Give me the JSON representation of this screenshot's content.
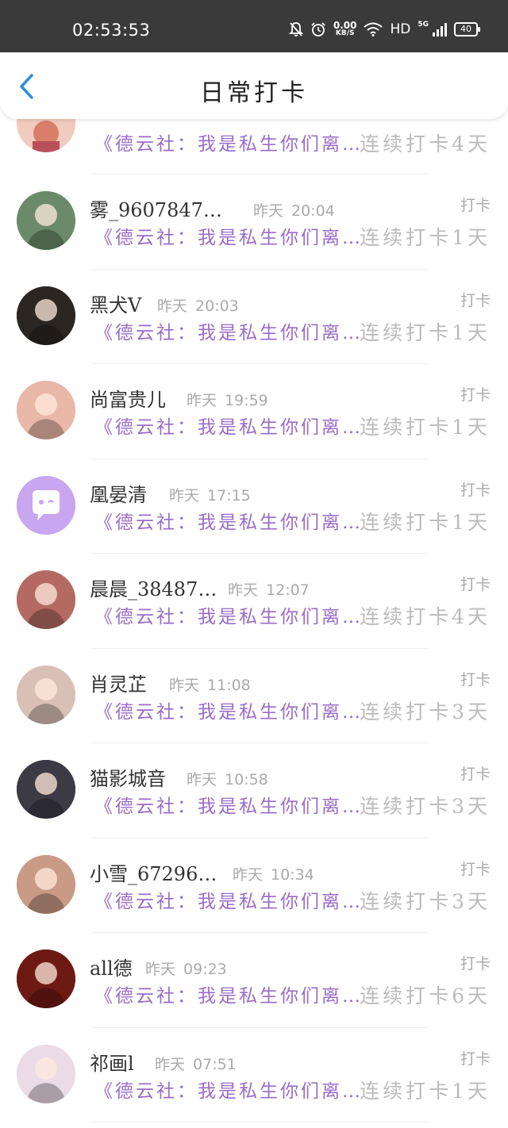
{
  "status_bar": {
    "time": "02:53:53",
    "net_speed_value": "0.00",
    "net_speed_unit": "KB/S",
    "hd": "HD",
    "network": "5G",
    "battery": "40"
  },
  "header": {
    "title": "日常打卡"
  },
  "list": {
    "first_partial": {
      "desc": "《德云社：我是私生你们离…",
      "streak": "连续打卡4天"
    },
    "rows": [
      {
        "name": "雾_9607847…",
        "day": "昨天",
        "time": "20:04",
        "label": "打卡",
        "desc": "《德云社：我是私生你们离…",
        "streak": "连续打卡1天",
        "avatar_color": "#6b8a6a",
        "avatar_icon": "avatar-photo-icon"
      },
      {
        "name": "黑犬V",
        "day": "昨天",
        "time": "20:03",
        "label": "打卡",
        "desc": "《德云社：我是私生你们离…",
        "streak": "连续打卡1天",
        "avatar_color": "#2b2622",
        "avatar_icon": "avatar-photo-icon"
      },
      {
        "name": "尚富贵儿",
        "day": "昨天",
        "time": "19:59",
        "label": "打卡",
        "desc": "《德云社：我是私生你们离…",
        "streak": "连续打卡1天",
        "avatar_color": "#e9b8a8",
        "avatar_icon": "avatar-photo-icon"
      },
      {
        "name": "凰晏清",
        "day": "昨天",
        "time": "17:15",
        "label": "打卡",
        "desc": "《德云社：我是私生你们离…",
        "streak": "连续打卡1天",
        "avatar_color": "#c8a6f0",
        "avatar_icon": "default-chat-avatar-icon"
      },
      {
        "name": "晨晨_38487…",
        "day": "昨天",
        "time": "12:07",
        "label": "打卡",
        "desc": "《德云社：我是私生你们离…",
        "streak": "连续打卡4天",
        "avatar_color": "#b46a62",
        "avatar_icon": "avatar-photo-icon"
      },
      {
        "name": "肖灵芷",
        "day": "昨天",
        "time": "11:08",
        "label": "打卡",
        "desc": "《德云社：我是私生你们离…",
        "streak": "连续打卡3天",
        "avatar_color": "#d9c0b6",
        "avatar_icon": "avatar-photo-icon"
      },
      {
        "name": "猫影城音",
        "day": "昨天",
        "time": "10:58",
        "label": "打卡",
        "desc": "《德云社：我是私生你们离…",
        "streak": "连续打卡3天",
        "avatar_color": "#3c3a44",
        "avatar_icon": "avatar-photo-icon"
      },
      {
        "name": "小雪_67296…",
        "day": "昨天",
        "time": "10:34",
        "label": "打卡",
        "desc": "《德云社：我是私生你们离…",
        "streak": "连续打卡3天",
        "avatar_color": "#c99a86",
        "avatar_icon": "avatar-photo-icon"
      },
      {
        "name": "all德",
        "day": "昨天",
        "time": "09:23",
        "label": "打卡",
        "desc": "《德云社：我是私生你们离…",
        "streak": "连续打卡6天",
        "avatar_color": "#6e1a14",
        "avatar_icon": "avatar-photo-icon"
      },
      {
        "name": "祁画l",
        "day": "昨天",
        "time": "07:51",
        "label": "打卡",
        "desc": "《德云社：我是私生你们离…",
        "streak": "连续打卡1天",
        "avatar_color": "#eadbe6",
        "avatar_icon": "avatar-photo-icon"
      }
    ]
  }
}
